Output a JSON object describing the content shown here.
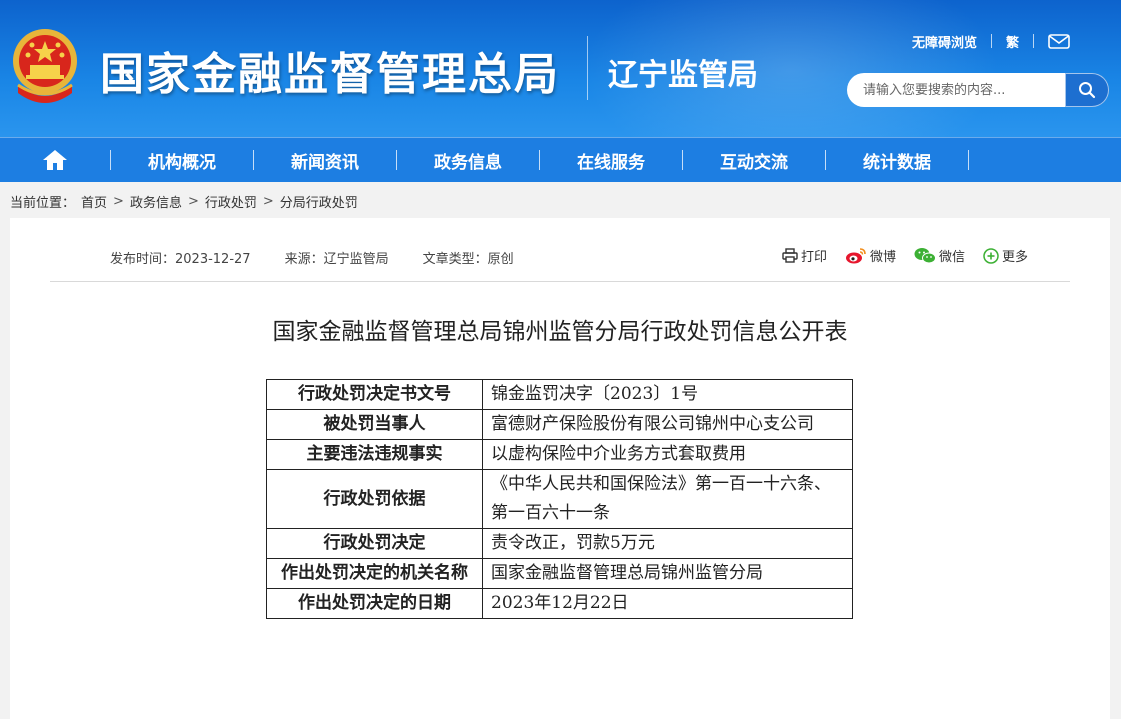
{
  "header": {
    "site_title": "国家金融监督管理总局",
    "branch": "辽宁监管局",
    "links": {
      "accessibility": "无障碍浏览",
      "traditional": "繁"
    },
    "icons": {
      "emblem": "national-emblem-icon",
      "mail": "mail-icon",
      "search": "search-icon"
    },
    "search": {
      "placeholder": "请输入您要搜索的内容..."
    }
  },
  "nav": {
    "home_icon": "home-icon",
    "items": [
      "机构概况",
      "新闻资讯",
      "政务信息",
      "在线服务",
      "互动交流",
      "统计数据"
    ]
  },
  "breadcrumb": {
    "label": "当前位置：",
    "items": [
      "首页",
      "政务信息",
      "行政处罚",
      "分局行政处罚"
    ]
  },
  "article": {
    "publish_time": "发布时间：2023-12-27",
    "source": "来源：辽宁监管局",
    "type": "文章类型：原创",
    "share": {
      "print": "打印",
      "weibo": "微博",
      "wechat": "微信",
      "more": "更多"
    },
    "title": "国家金融监督管理总局锦州监管分局行政处罚信息公开表",
    "table": [
      {
        "k": "行政处罚决定书文号",
        "v": "锦金监罚决字〔2023〕1号"
      },
      {
        "k": "被处罚当事人",
        "v": "富德财产保险股份有限公司锦州中心支公司"
      },
      {
        "k": "主要违法违规事实",
        "v": "以虚构保险中介业务方式套取费用"
      },
      {
        "k": "行政处罚依据",
        "v": "《中华人民共和国保险法》第一百一十六条、第一百六十一条"
      },
      {
        "k": "行政处罚决定",
        "v": "责令改正，罚款5万元"
      },
      {
        "k": "作出处罚决定的机关名称",
        "v": "国家金融监督管理总局锦州监管分局"
      },
      {
        "k": "作出处罚决定的日期",
        "v": "2023年12月22日"
      }
    ]
  },
  "colors": {
    "header_blue": "#0d63cd",
    "nav_blue": "#1d7ee2",
    "text": "#222222"
  }
}
